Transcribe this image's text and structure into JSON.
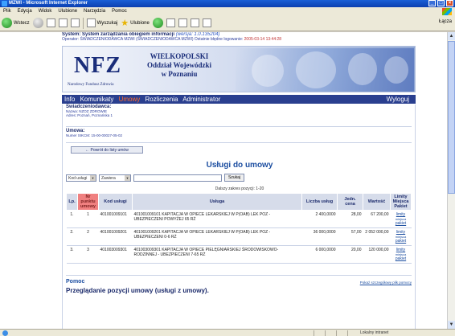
{
  "window": {
    "title": "MZWI - Microsoft Internet Explorer",
    "controls": [
      "_",
      "□",
      "×"
    ]
  },
  "menu": [
    "Plik",
    "Edycja",
    "Widok",
    "Ulubione",
    "Narzędzia",
    "Pomoc"
  ],
  "toolbar": {
    "back_label": "Wstecz",
    "search_label": "Wyszukaj",
    "favorites_label": "Ulubione",
    "links_label": "Łącza"
  },
  "page": {
    "system_line": "System: System zarządzania obiegiem informacji",
    "version": "(wersja: 1.0.135204)",
    "operator_line": "Operator: ŚWIADCZENIODAWCA MZWI",
    "operator_bracket": "(ŚWIADCZENIODAWCA MZWI)",
    "last_login_label": "Ostatnie błędne logowanie:",
    "last_login": "2005-03-14 13:44:28",
    "logo": "NFZ",
    "logo_sub": "Narodowy Fundusz Zdrowia",
    "region_line1": "WIELKOPOLSKI",
    "region_line2": "Oddział Wojewódzki",
    "region_line3": "w Poznaniu",
    "nav": [
      "Info",
      "Komunikaty",
      "Umowy",
      "Rozliczenia",
      "Administrator"
    ],
    "nav_active": "Umowy",
    "logout": "Wyloguj",
    "provider_title": "Świadczeniodawca:",
    "provider_name": "Nazwa: NZOZ ZDROWIE",
    "provider_address": "Adres: Poznań, Poznańska 1",
    "contract_title": "Umowa:",
    "contract_number": "Numer SIKCM: 15-00-00027-05-02",
    "back_button": "← Powrót do listy umów",
    "page_title": "Usługi do umowy",
    "filter_field": "Kod usługi",
    "filter_op": "Zawiera",
    "search_button": "Szukaj",
    "range_text": "Dalszy zakres pozycji: 1-20",
    "columns": [
      "Lp.",
      "Nr punktu umowy",
      "Kod usługi",
      "Usługa",
      "Liczba usług",
      "Jedn. cena",
      "Wartość",
      "Limity Miejsca Pakiet"
    ],
    "rows": [
      {
        "lp": "1.",
        "nr": "1",
        "kod": "401001009101",
        "usluga": "401001009101 KAPITACJA W OPIECE LEKARSKIEJ W P(OAB) LEK POZ - UBEZPIECZENI POWYŻEJ 65 RŻ",
        "liczba": "2 400,0000",
        "cena": "28,00",
        "wartosc": "67 200,00",
        "links": [
          "limity",
          "miejsca",
          "pakiet"
        ]
      },
      {
        "lp": "2.",
        "nr": "2",
        "kod": "401001009201",
        "usluga": "401001009201 KAPITACJA W OPIECE LEKARSKIEJ W P(OAB) LEK POZ - UBEZPIECZENI 0-6 RŻ",
        "liczba": "36 000,0000",
        "cena": "57,00",
        "wartosc": "2 052 000,00",
        "links": [
          "limity",
          "miejsca",
          "pakiet"
        ]
      },
      {
        "lp": "3.",
        "nr": "3",
        "kod": "401003009301",
        "usluga": "401003009301 KAPITACJA W OPIECE PIELĘGNIARSKIEJ ŚRODOWISKOWO-RODZINNEJ - UBEZPIECZENI 7-65 RŻ",
        "liczba": "6 000,0000",
        "cena": "20,00",
        "wartosc": "120 000,00",
        "links": [
          "limity",
          "miejsca",
          "pakiet"
        ]
      }
    ],
    "help_title": "Pomoc",
    "help_all": "Pokaż szczegółowy plik pomocy",
    "help_sub": "Przeglądanie pozycji umowy (usługi z umowy)."
  },
  "status": {
    "zone": "Lokalny intranet"
  },
  "colors": {
    "nav_bg": "#2a3f8f",
    "nav_active": "#ff6b2b",
    "header_highlight": "#f08080"
  }
}
